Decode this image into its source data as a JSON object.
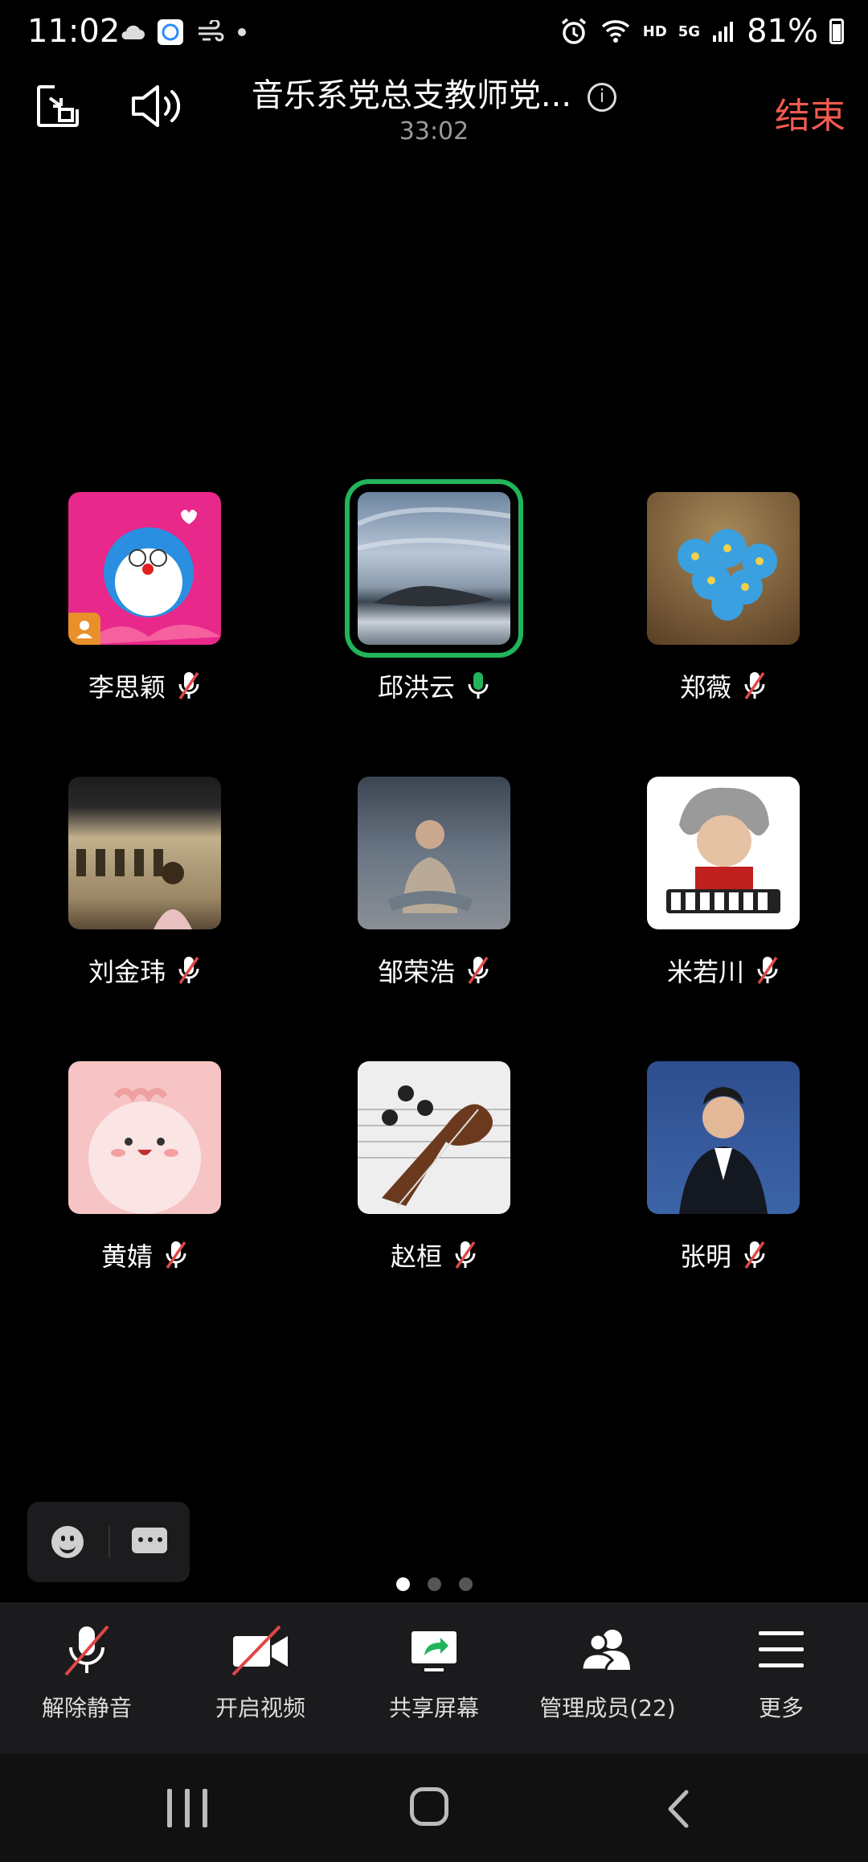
{
  "status_bar": {
    "time": "11:02",
    "battery": "81%",
    "network": "5G",
    "hd": "HD"
  },
  "header": {
    "title": "音乐系党总支教师党...",
    "timer": "33:02",
    "end_label": "结束"
  },
  "participants": [
    {
      "name": "李思颖",
      "mic": "muted",
      "host": true
    },
    {
      "name": "邱洪云",
      "mic": "active",
      "speaking": true
    },
    {
      "name": "郑薇",
      "mic": "muted"
    },
    {
      "name": "刘金玮",
      "mic": "muted"
    },
    {
      "name": "邹荣浩",
      "mic": "muted"
    },
    {
      "name": "米若川",
      "mic": "muted"
    },
    {
      "name": "黄婧",
      "mic": "muted"
    },
    {
      "name": "赵桓",
      "mic": "muted"
    },
    {
      "name": "张明",
      "mic": "muted"
    }
  ],
  "pagination": {
    "current": 1,
    "total": 3
  },
  "toolbar": {
    "unmute": "解除静音",
    "video": "开启视频",
    "share": "共享屏幕",
    "members": "管理成员(22)",
    "more": "更多"
  },
  "colors": {
    "end": "#f25b4f",
    "speaking_ring": "#22b45a",
    "mic_active": "#22b45a",
    "mute_slash": "#e04848"
  }
}
